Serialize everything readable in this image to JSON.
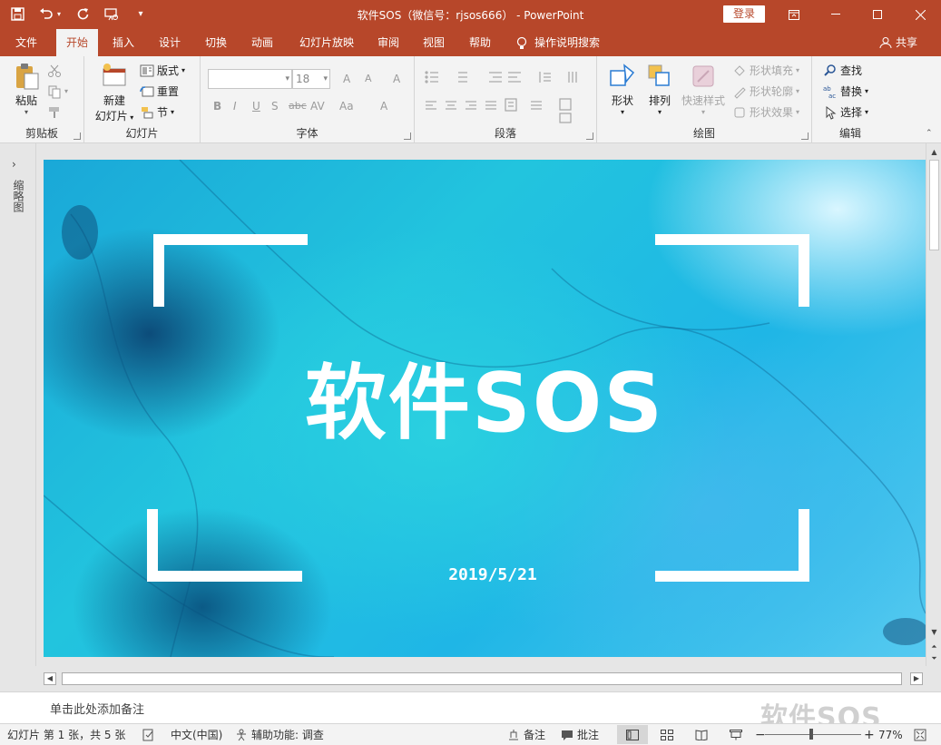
{
  "window": {
    "title": "软件SOS（微信号：rjsos666） - PowerPoint",
    "login_label": "登录",
    "qat_customize": "▾"
  },
  "tabs": [
    {
      "label": "文件"
    },
    {
      "label": "开始",
      "active": true
    },
    {
      "label": "插入"
    },
    {
      "label": "设计"
    },
    {
      "label": "切换"
    },
    {
      "label": "动画"
    },
    {
      "label": "幻灯片放映"
    },
    {
      "label": "审阅"
    },
    {
      "label": "视图"
    },
    {
      "label": "帮助"
    }
  ],
  "tell_me": "操作说明搜索",
  "share": "共享",
  "ribbon": {
    "clipboard": {
      "label": "剪贴板",
      "paste": "粘贴"
    },
    "slides": {
      "label": "幻灯片",
      "new_slide_line1": "新建",
      "new_slide_line2": "幻灯片",
      "layout": "版式",
      "reset": "重置",
      "section": "节"
    },
    "font": {
      "label": "字体",
      "font_name": "",
      "font_size": "18",
      "grow": "A",
      "shrink": "A",
      "clear": "A",
      "bold": "B",
      "italic": "I",
      "underline": "U",
      "shadow": "S",
      "strike": "abc",
      "spacing": "AV",
      "case": "Aa",
      "color": "A"
    },
    "paragraph": {
      "label": "段落"
    },
    "drawing": {
      "label": "绘图",
      "shapes": "形状",
      "arrange": "排列",
      "quick_styles": "快速样式",
      "shape_fill": "形状填充",
      "shape_outline": "形状轮廓",
      "shape_effects": "形状效果"
    },
    "editing": {
      "label": "编辑",
      "find": "查找",
      "replace": "替换",
      "select": "选择"
    }
  },
  "left_panel": {
    "expand": "›",
    "label": "缩略图"
  },
  "slide": {
    "title": "软件SOS",
    "date": "2019/5/21"
  },
  "notes": {
    "placeholder": "单击此处添加备注",
    "watermark": "软件SOS"
  },
  "status": {
    "slide_info": "幻灯片 第 1 张，共 5 张",
    "language": "中文(中国)",
    "accessibility": "辅助功能: 调查",
    "notes": "备注",
    "comments": "批注",
    "zoom_minus": "−",
    "zoom_plus": "+",
    "zoom": "77%"
  },
  "colors": {
    "accent": "#b7472a",
    "ribbon_bg": "#f3f3f3"
  }
}
